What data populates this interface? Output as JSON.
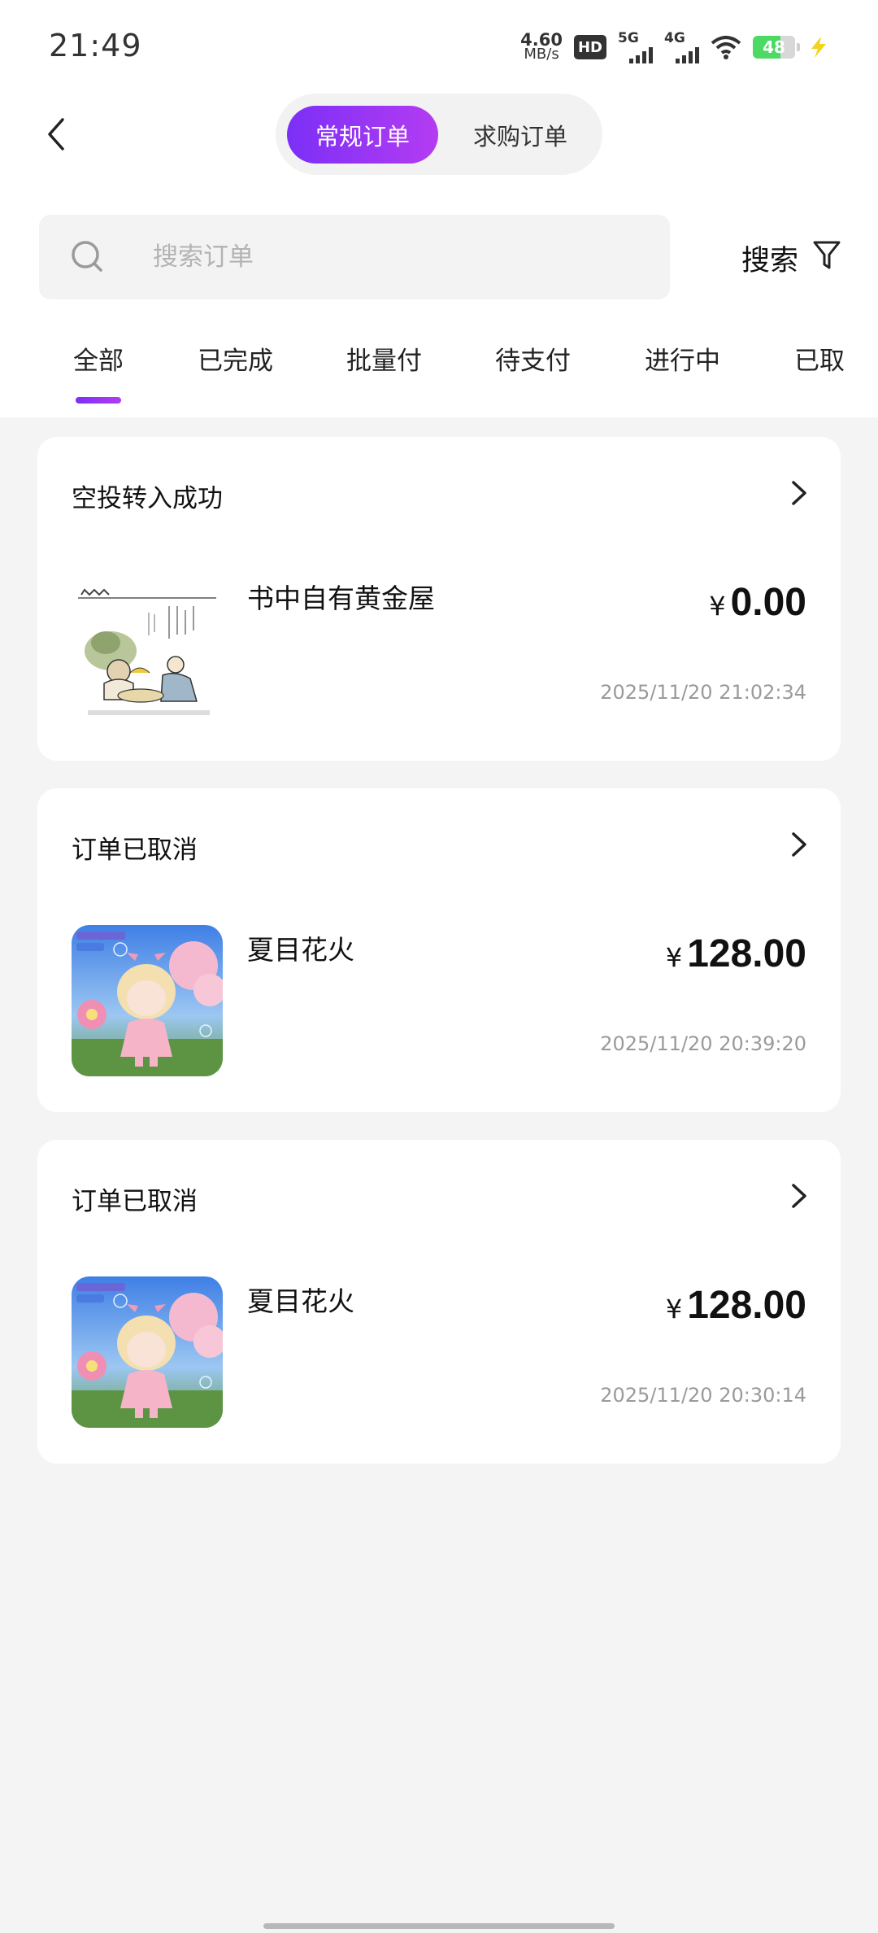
{
  "status_bar": {
    "time": "21:49",
    "net_speed": "4.60",
    "net_unit": "MB/s",
    "hd": "HD",
    "sim1_label": "5G",
    "sim2_label": "4G",
    "battery": "48"
  },
  "header": {
    "tabs": [
      {
        "label": "常规订单",
        "active": true
      },
      {
        "label": "求购订单",
        "active": false
      }
    ]
  },
  "search": {
    "placeholder": "搜索订单",
    "value": "",
    "button_label": "搜索"
  },
  "filter_tabs": [
    {
      "label": "全部",
      "active": true
    },
    {
      "label": "已完成"
    },
    {
      "label": "批量付"
    },
    {
      "label": "待支付"
    },
    {
      "label": "进行中"
    },
    {
      "label": "已取"
    }
  ],
  "orders": [
    {
      "status": "空投转入成功",
      "product_name": "书中自有黄金屋",
      "currency": "¥",
      "amount": "0.00",
      "time": "2025/11/20 21:02:34",
      "thumb": "ink-painting"
    },
    {
      "status": "订单已取消",
      "product_name": "夏目花火",
      "currency": "¥",
      "amount": "128.00",
      "time": "2025/11/20 20:39:20",
      "thumb": "doll-figure"
    },
    {
      "status": "订单已取消",
      "product_name": "夏目花火",
      "currency": "¥",
      "amount": "128.00",
      "time": "2025/11/20 20:30:14",
      "thumb": "doll-figure"
    }
  ],
  "colors": {
    "accent_start": "#7b2ff7",
    "accent_end": "#b43cf2",
    "background": "#f4f4f4"
  }
}
